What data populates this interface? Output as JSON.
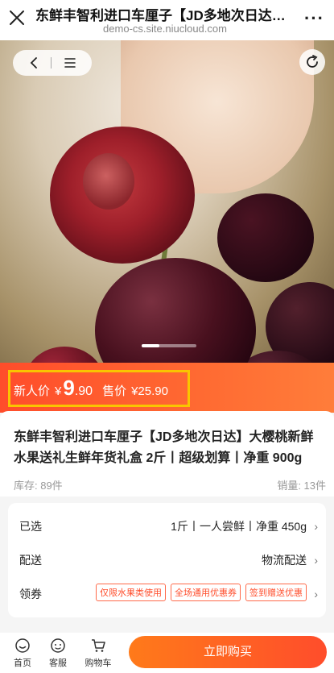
{
  "header": {
    "title": "东鲜丰智利进口车厘子【JD多地次日达】大樱桃新鲜水果送礼生鲜年货礼盒",
    "url": "demo-cs.site.niucloud.com",
    "more": "···"
  },
  "hero": {
    "slide_current": 1
  },
  "price": {
    "new_label": "新人价",
    "currency": "¥",
    "new_int": "9",
    "new_dec": ".90",
    "sale_label": "售价",
    "original": "¥25.90",
    "highlight_color": "#f9c500",
    "accent_color": "#ff4d2b"
  },
  "product": {
    "name": "东鲜丰智利进口车厘子【JD多地次日达】大樱桃新鲜水果送礼生鲜年货礼盒 2斤丨超级划算丨净重 900g",
    "stock": "库存: 89件",
    "sales": "销量: 13件"
  },
  "options": {
    "selected_label": "已选",
    "selected_value": "1斤丨一人尝鲜丨净重 450g",
    "delivery_label": "配送",
    "delivery_value": "物流配送",
    "coupon_label": "领券",
    "coupons": [
      "仅限水果类使用",
      "全场通用优惠券",
      "签到赠送优惠"
    ]
  },
  "bottom": {
    "home": "首页",
    "service": "客服",
    "cart": "购物车",
    "buy_now": "立即购买"
  }
}
